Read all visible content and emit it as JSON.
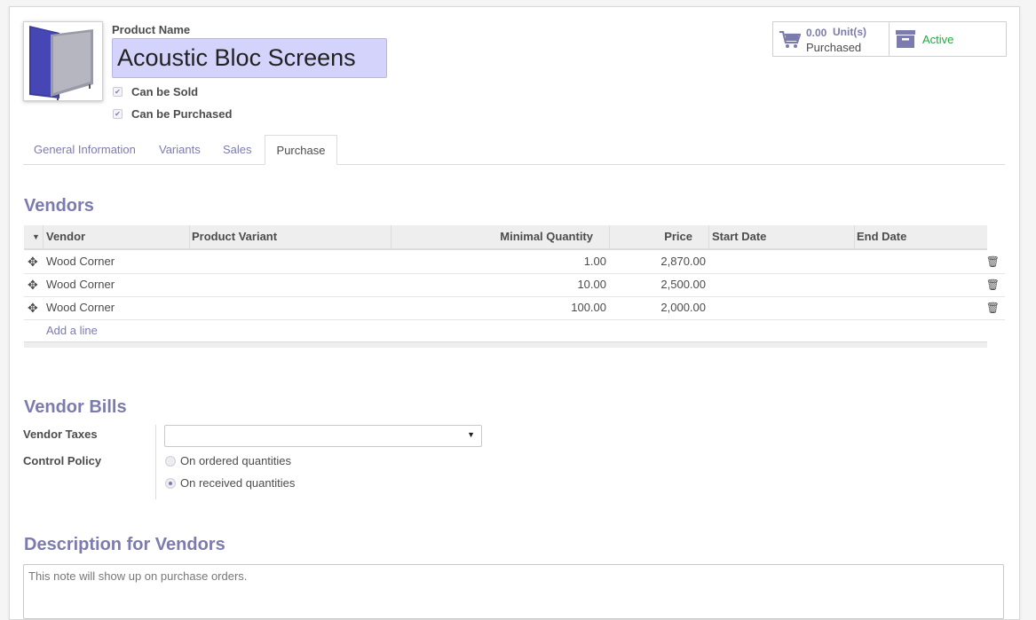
{
  "product": {
    "name_label": "Product Name",
    "name": "Acoustic Bloc Screens",
    "can_be_sold_label": "Can be Sold",
    "can_be_sold": true,
    "can_be_purchased_label": "Can be Purchased",
    "can_be_purchased": true,
    "image_icon": "acoustic-screen-image"
  },
  "smart_buttons": {
    "purchased_value": "0.00",
    "purchased_unit": "Unit(s)",
    "purchased_label": "Purchased",
    "active_label": "Active"
  },
  "tabs": [
    {
      "label": "General Information",
      "active": false
    },
    {
      "label": "Variants",
      "active": false
    },
    {
      "label": "Sales",
      "active": false
    },
    {
      "label": "Purchase",
      "active": true
    }
  ],
  "vendors": {
    "title": "Vendors",
    "columns": [
      "Vendor",
      "Product Variant",
      "Minimal Quantity",
      "Price",
      "Start Date",
      "End Date"
    ],
    "rows": [
      {
        "vendor": "Wood Corner",
        "variant": "",
        "min_qty": "1.00",
        "price": "2,870.00",
        "start": "",
        "end": ""
      },
      {
        "vendor": "Wood Corner",
        "variant": "",
        "min_qty": "10.00",
        "price": "2,500.00",
        "start": "",
        "end": ""
      },
      {
        "vendor": "Wood Corner",
        "variant": "",
        "min_qty": "100.00",
        "price": "2,000.00",
        "start": "",
        "end": ""
      }
    ],
    "add_line": "Add a line"
  },
  "vendor_bills": {
    "title": "Vendor Bills",
    "taxes_label": "Vendor Taxes",
    "taxes_value": "",
    "control_label": "Control Policy",
    "options": [
      "On ordered quantities",
      "On received quantities"
    ],
    "selected_option": "On received quantities"
  },
  "description": {
    "title": "Description for Vendors",
    "placeholder": "This note will show up on purchase orders."
  },
  "colors": {
    "accent": "#7c7bad",
    "active_green": "#28a745",
    "name_bg": "#d3d3fb"
  }
}
